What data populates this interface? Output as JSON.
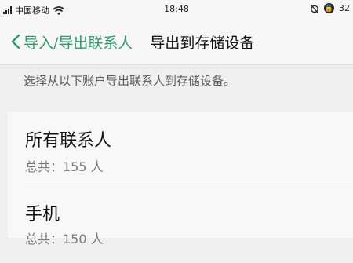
{
  "status_bar": {
    "carrier": "中国移动",
    "time": "18:48",
    "battery": "32"
  },
  "nav": {
    "back_label": "导入/导出联系人",
    "title": "导出到存储设备"
  },
  "instruction": "选择从以下账户导出联系人到存储设备。",
  "accounts": [
    {
      "name": "所有联系人",
      "count": "总共：155 人"
    },
    {
      "name": "手机",
      "count": "总共：150 人"
    }
  ],
  "colors": {
    "accent": "#2a9d6a"
  },
  "icons": [
    "signal-icon",
    "wifi-icon",
    "alarm-icon",
    "lock-icon",
    "chevron-left-icon"
  ]
}
